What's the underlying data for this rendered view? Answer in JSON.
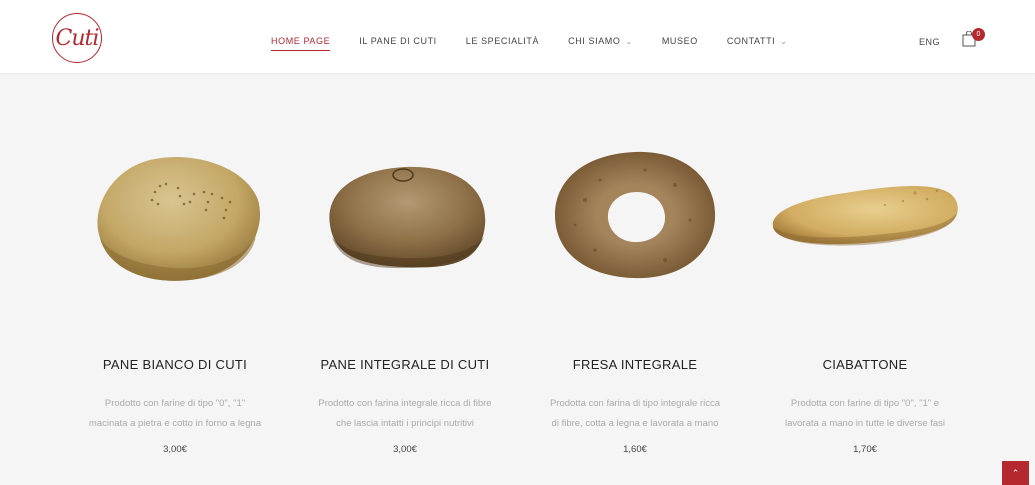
{
  "header": {
    "logo_text": "Cuti",
    "nav": [
      {
        "label": "HOME PAGE",
        "active": true,
        "dropdown": false
      },
      {
        "label": "IL PANE DI CUTI",
        "active": false,
        "dropdown": false
      },
      {
        "label": "LE SPECIALITÀ",
        "active": false,
        "dropdown": false
      },
      {
        "label": "CHI SIAMO",
        "active": false,
        "dropdown": true
      },
      {
        "label": "MUSEO",
        "active": false,
        "dropdown": false
      },
      {
        "label": "CONTATTI",
        "active": false,
        "dropdown": true
      }
    ],
    "lang": "ENG",
    "cart_count": "0"
  },
  "products": [
    {
      "name": "PANE BIANCO DI CUTI",
      "desc_1": "Prodotto con farine di tipo \"0\", \"1\"",
      "desc_2": "macinata a pietra e cotto in forno a legna",
      "price": "3,00€",
      "image": "round-white-loaf"
    },
    {
      "name": "PANE INTEGRALE DI CUTI",
      "desc_1": "Prodotto con farina integrale ricca di fibre",
      "desc_2": "che lascia intatti i principi nutritivi",
      "price": "3,00€",
      "image": "wholewheat-loaf"
    },
    {
      "name": "FRESA INTEGRALE",
      "desc_1": "Prodotta con farina di tipo integrale ricca",
      "desc_2": "di fibre, cotta a legna e lavorata a mano",
      "price": "1,60€",
      "image": "ring-bread"
    },
    {
      "name": "CIABATTONE",
      "desc_1": "Prodotta con farine di tipo \"0\", \"1\" e",
      "desc_2": "lavorata a mano in tutte le diverse fasi",
      "price": "1,70€",
      "image": "flat-ciabatta"
    }
  ],
  "colors": {
    "accent": "#b52830",
    "background": "#f5f5f5"
  }
}
